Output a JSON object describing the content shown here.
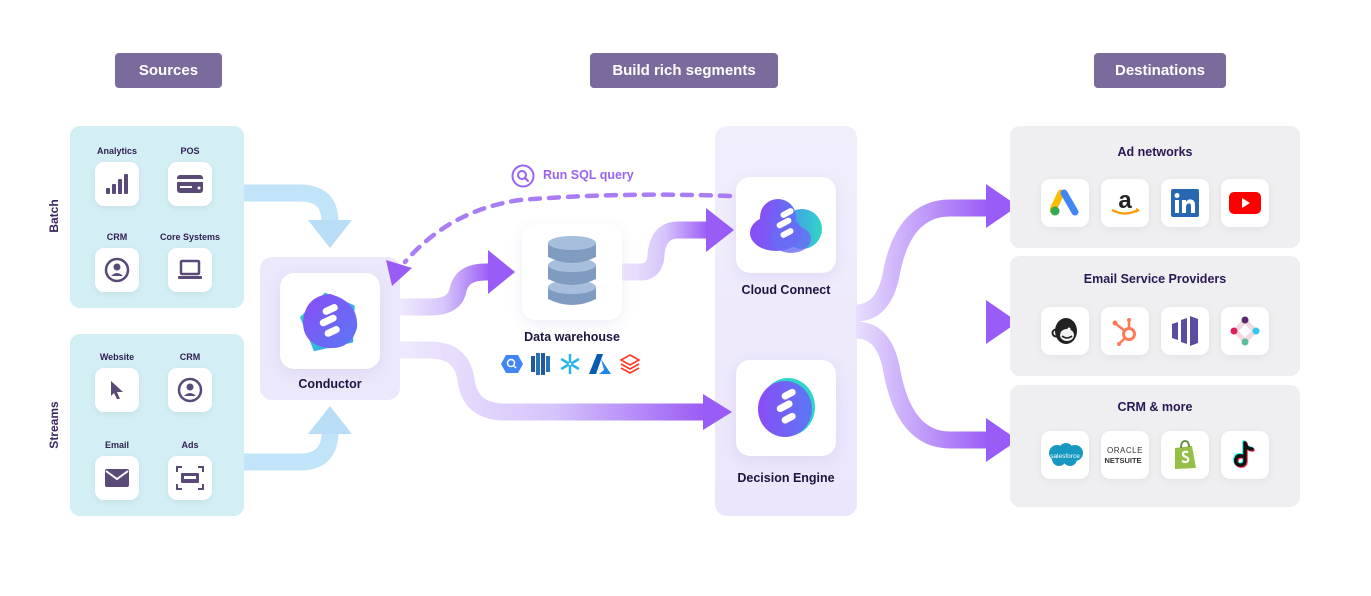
{
  "headers": {
    "sources": "Sources",
    "segments": "Build rich segments",
    "destinations": "Destinations"
  },
  "sources": {
    "batch": {
      "label": "Batch",
      "items": [
        {
          "label": "Analytics",
          "icon": "bar-chart-icon"
        },
        {
          "label": "POS",
          "icon": "credit-card-icon"
        },
        {
          "label": "CRM",
          "icon": "user-circle-icon"
        },
        {
          "label": "Core Systems",
          "icon": "laptop-icon"
        }
      ]
    },
    "streams": {
      "label": "Streams",
      "items": [
        {
          "label": "Website",
          "icon": "cursor-icon"
        },
        {
          "label": "CRM",
          "icon": "user-circle-icon"
        },
        {
          "label": "Email",
          "icon": "envelope-icon"
        },
        {
          "label": "Ads",
          "icon": "ad-frame-icon"
        }
      ]
    }
  },
  "conductor": {
    "label": "Conductor"
  },
  "sql_query": {
    "label": "Run SQL query"
  },
  "data_warehouse": {
    "label": "Data warehouse",
    "logos": [
      "bigquery",
      "redshift",
      "snowflake",
      "azure",
      "databricks"
    ]
  },
  "cloud_connect": {
    "label": "Cloud Connect"
  },
  "decision_engine": {
    "label": "Decision Engine"
  },
  "destinations": [
    {
      "title": "Ad networks",
      "logos": [
        "google-ads",
        "amazon",
        "linkedin",
        "youtube"
      ]
    },
    {
      "title": "Email Service Providers",
      "logos": [
        "mailchimp",
        "hubspot",
        "marketo",
        "slack-like"
      ]
    },
    {
      "title": "CRM & more",
      "logos": [
        "salesforce",
        "oracle-netsuite",
        "shopify",
        "tiktok"
      ]
    }
  ],
  "logo_text": {
    "salesforce": "salesforce",
    "oracle": "ORACLE",
    "netsuite": "NETSUITE",
    "amazon": "a",
    "linkedin": "in"
  },
  "colors": {
    "header_pill": "#7a6b9c",
    "source_panel": "#d3eef4",
    "hub_panel": "#ece8fb",
    "flow_purple": "#9a5cf6",
    "flow_blue": "#b9ddf7",
    "dest_panel": "#efeff1",
    "icon_dark": "#5a4a78"
  }
}
